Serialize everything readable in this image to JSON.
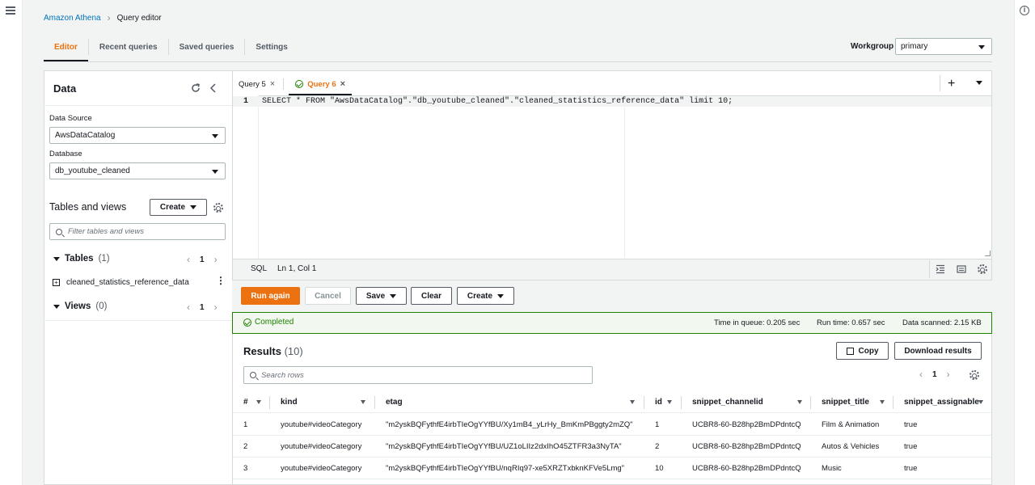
{
  "breadcrumb": {
    "root": "Amazon Athena",
    "current": "Query editor"
  },
  "tabs": [
    "Editor",
    "Recent queries",
    "Saved queries",
    "Settings"
  ],
  "workgroup": {
    "label": "Workgroup",
    "value": "primary"
  },
  "data_panel": {
    "title": "Data",
    "data_source_label": "Data Source",
    "data_source_value": "AwsDataCatalog",
    "database_label": "Database",
    "database_value": "db_youtube_cleaned",
    "tables_views_title": "Tables and views",
    "create_label": "Create",
    "filter_placeholder": "Filter tables and views",
    "tables_label": "Tables",
    "tables_count": "(1)",
    "tables_page": "1",
    "table_item": "cleaned_statistics_reference_data",
    "views_label": "Views",
    "views_count": "(0)",
    "views_page": "1"
  },
  "editor": {
    "query_tabs": [
      "Query 5",
      "Query 6"
    ],
    "line_number": "1",
    "sql": "SELECT * FROM \"AwsDataCatalog\".\"db_youtube_cleaned\".\"cleaned_statistics_reference_data\" limit 10;",
    "status_lang": "SQL",
    "status_pos": "Ln 1, Col 1"
  },
  "actions": {
    "run": "Run again",
    "cancel": "Cancel",
    "save": "Save",
    "clear": "Clear",
    "create": "Create"
  },
  "status": {
    "text": "Completed",
    "queue_label": "Time in queue:",
    "queue_value": "0.205 sec",
    "run_label": "Run time:",
    "run_value": "0.657 sec",
    "scan_label": "Data scanned:",
    "scan_value": "2.15 KB"
  },
  "results": {
    "title": "Results",
    "count": "(10)",
    "copy": "Copy",
    "download": "Download results",
    "search_placeholder": "Search rows",
    "page": "1",
    "columns": [
      "#",
      "kind",
      "etag",
      "id",
      "snippet_channelid",
      "snippet_title",
      "snippet_assignable"
    ],
    "rows": [
      [
        "1",
        "youtube#videoCategory",
        "\"m2yskBQFythfE4irbTIeOgYYfBU/Xy1mB4_yLrHy_BmKmPBggty2mZQ\"",
        "1",
        "UCBR8-60-B28hp2BmDPdntcQ",
        "Film & Animation",
        "true"
      ],
      [
        "2",
        "youtube#videoCategory",
        "\"m2yskBQFythfE4irbTIeOgYYfBU/UZ1oLIIz2dxIhO45ZTFR3a3NyTA\"",
        "2",
        "UCBR8-60-B28hp2BmDPdntcQ",
        "Autos & Vehicles",
        "true"
      ],
      [
        "3",
        "youtube#videoCategory",
        "\"m2yskBQFythfE4irbTIeOgYYfBU/nqRIq97-xe5XRZTxbknKFVe5Lmg\"",
        "10",
        "UCBR8-60-B28hp2BmDPdntcQ",
        "Music",
        "true"
      ]
    ]
  },
  "colors": {
    "accent": "#ec7211",
    "link": "#0073bb",
    "success": "#1d8102"
  }
}
